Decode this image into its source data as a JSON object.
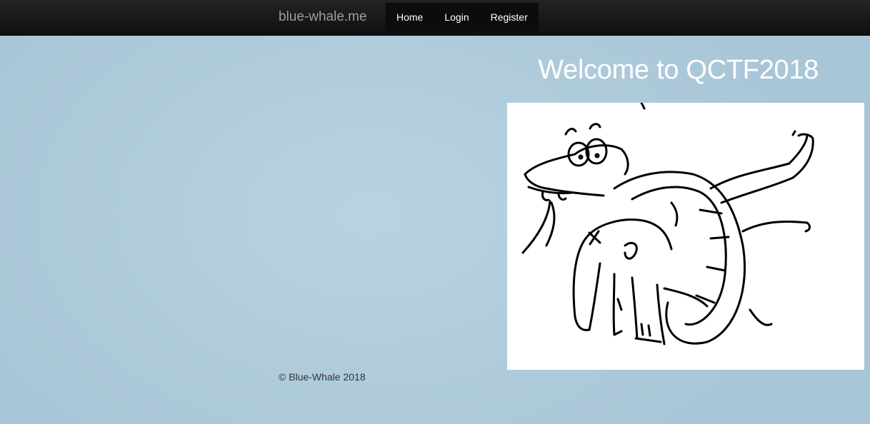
{
  "navbar": {
    "brand": "blue-whale.me",
    "items": [
      {
        "label": "Home"
      },
      {
        "label": "Login"
      },
      {
        "label": "Register"
      }
    ]
  },
  "main": {
    "title": "Welcome to QCTF2018",
    "image_icon": "snake-swallowing-elephant-sketch"
  },
  "footer": {
    "copyright": "© Blue-Whale 2018"
  },
  "colors": {
    "navbar_bg": "#161616",
    "page_bg": "#b1cddc",
    "title_text": "#ffffff"
  }
}
